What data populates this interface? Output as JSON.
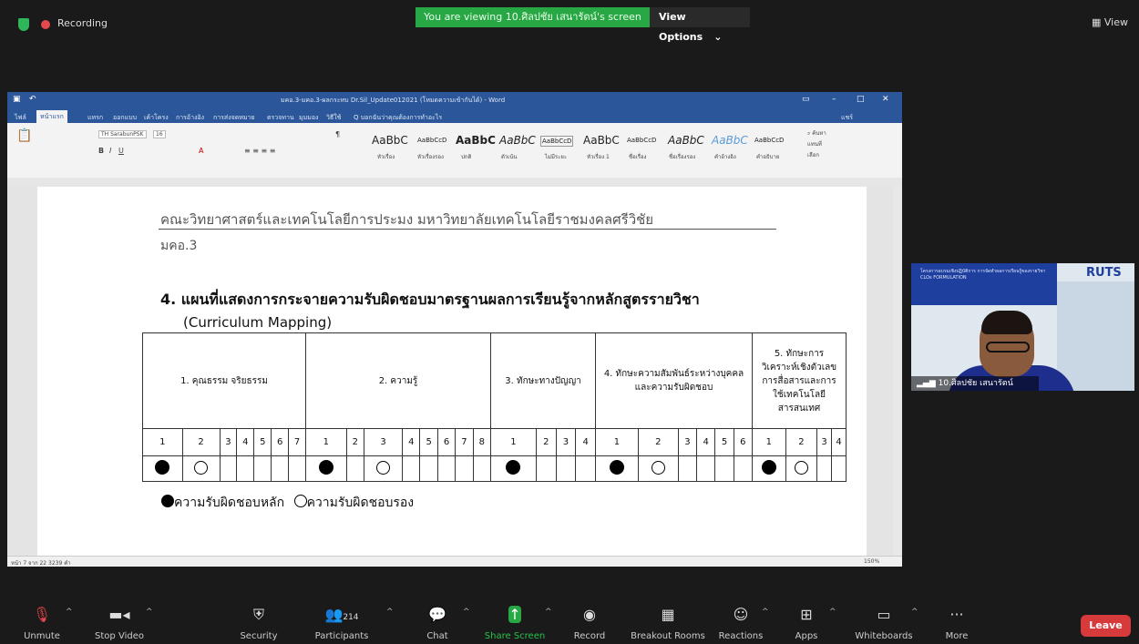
{
  "meeting": {
    "recording_label": "Recording",
    "viewing_text": "You are viewing 10.ศิลปชัย เสนารัตน์'s screen",
    "view_options_label": "View Options",
    "view_label": "View"
  },
  "word": {
    "title": "มคอ.3-มคอ.3-ผลกระทบ Dr.Sil_Update012021 (โหมดความเข้ากันได้) - Word",
    "tabs": [
      "ไฟล์",
      "หน้าแรก",
      "แทรก",
      "ออกแบบ",
      "เค้าโครง",
      "การอ้างอิง",
      "การส่งจดหมาย",
      "ตรวจทาน",
      "มุมมอง",
      "วิธีใช้",
      "Q บอกฉันว่าคุณต้องการทำอะไร"
    ],
    "share_label": "แชร์",
    "font_name": "TH SarabunPSK",
    "font_size": "16",
    "styles": [
      "AaBbC",
      "AaBbCcD",
      "AaBbC",
      "AaBbC",
      "AaBbCcD",
      "AaBbC",
      "AaBbCcD",
      "AaBbC",
      "AaBbC",
      "AaBbCcD"
    ],
    "style_names": [
      "หัวเรื่อง",
      "หัวเรื่องรอง",
      "ปกติ",
      "ตัวเน้น",
      "ไม่มีระยะ",
      "หัวเรื่อง 1",
      "ชื่อเรื่อง",
      "ชื่อเรื่องรอง",
      "คำอ้างอิง",
      "คำอธิบาย"
    ],
    "find_label": "ค้นหา",
    "replace_label": "แทนที่",
    "select_label": "เลือก",
    "status_left": "หน้า 7 จาก 22   3239 คำ",
    "zoom": "150%"
  },
  "document": {
    "header": "คณะวิทยาศาสตร์และเทคโนโลยีการประมง  มหาวิทยาลัยเทคโนโลยีราชมงคลศรีวิชัย",
    "form_id": "มคอ.3",
    "heading": "4.  แผนที่แสดงการกระจายความรับผิดชอบมาตรฐานผลการเรียนรู้จากหลักสูตรรายวิชา",
    "heading_sub": "(Curriculum Mapping)",
    "table": {
      "groups": [
        {
          "label": "1. คุณธรรม จริยธรรม",
          "items": [
            "1",
            "2",
            "3",
            "4",
            "5",
            "6",
            "7"
          ],
          "marks": [
            "filled",
            "empty",
            "",
            "",
            "",
            "",
            ""
          ]
        },
        {
          "label": "2. ความรู้",
          "items": [
            "1",
            "2",
            "3",
            "4",
            "5",
            "6",
            "7",
            "8"
          ],
          "marks": [
            "filled",
            "",
            "empty",
            "",
            "",
            "",
            "",
            ""
          ]
        },
        {
          "label": "3. ทักษะทางปัญญา",
          "items": [
            "1",
            "2",
            "3",
            "4"
          ],
          "marks": [
            "filled",
            "",
            "",
            ""
          ]
        },
        {
          "label": "4. ทักษะความสัมพันธ์ระหว่างบุคคลและความรับผิดชอบ",
          "items": [
            "1",
            "2",
            "3",
            "4",
            "5",
            "6"
          ],
          "marks": [
            "filled",
            "empty",
            "",
            "",
            "",
            ""
          ]
        },
        {
          "label": "5. ทักษะการวิเคราะห์เชิงตัวเลข การสื่อสารและการใช้เทคโนโลยีสารสนเทศ",
          "items": [
            "1",
            "2",
            "3",
            "4"
          ],
          "marks": [
            "filled",
            "empty",
            "",
            ""
          ]
        }
      ]
    },
    "legend_primary": "ความรับผิดชอบหลัก",
    "legend_secondary": "ความรับผิดชอบรอง"
  },
  "participant": {
    "name": "10.ศิลปชัย เสนารัตน์",
    "logo": "RUTS",
    "banner_text": "โครงการอบรมเชิงปฏิบัติการ การจัดทำผลการเรียนรู้ของรายวิชา CLOs FORMULATION"
  },
  "toolbar": {
    "unmute": "Unmute",
    "stop_video": "Stop Video",
    "security": "Security",
    "participants": "Participants",
    "participants_count": "214",
    "chat": "Chat",
    "share_screen": "Share Screen",
    "record": "Record",
    "breakout_rooms": "Breakout Rooms",
    "reactions": "Reactions",
    "apps": "Apps",
    "whiteboards": "Whiteboards",
    "more": "More",
    "leave": "Leave"
  }
}
